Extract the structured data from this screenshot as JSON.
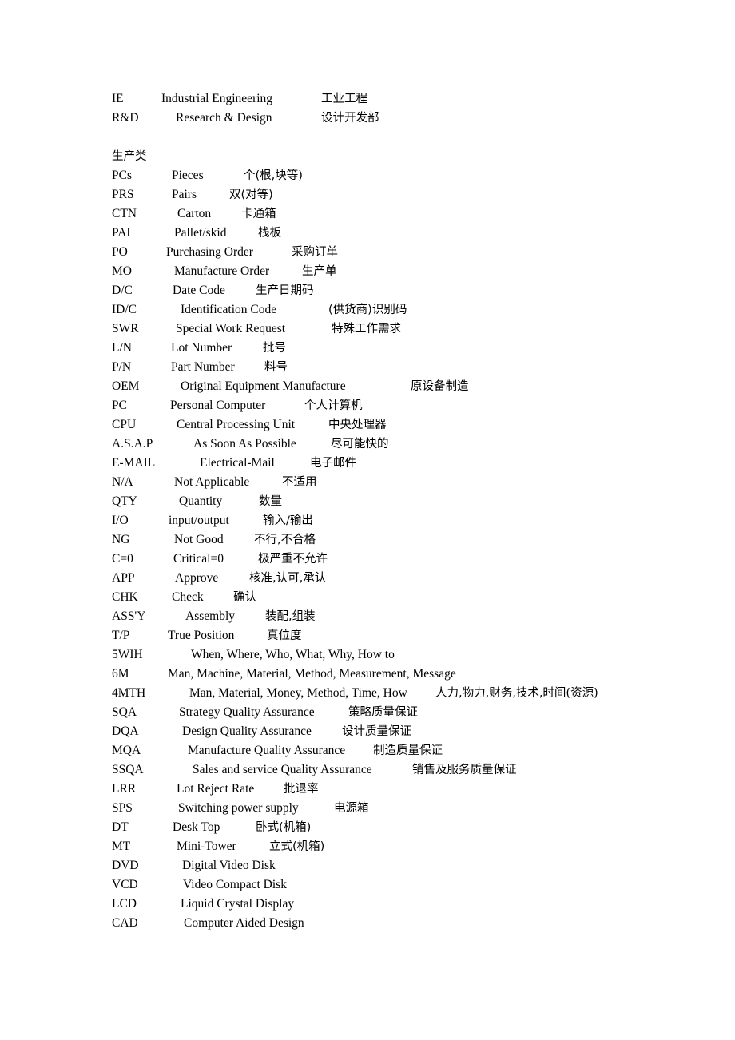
{
  "document": {
    "type": "glossary-list",
    "language_note": "English abbreviation / English expansion / Chinese meaning",
    "section_heading": "生产类",
    "rows": [
      {
        "abbr": "IE",
        "term": "Industrial Engineering",
        "cn": "工业工程",
        "abbr_w": 62,
        "term_w": 200
      },
      {
        "abbr": "R&D",
        "term": "Research & Design",
        "cn": "设计开发部",
        "abbr_w": 80,
        "term_w": 182
      },
      {
        "abbr": "",
        "term": "",
        "cn": "",
        "abbr_w": 0,
        "term_w": 0
      },
      {
        "abbr": "",
        "term": "",
        "cn": "",
        "abbr_w": 0,
        "term_w": 0
      },
      {
        "abbr": "PCs",
        "term": "Pieces",
        "cn": "个(根,块等)",
        "abbr_w": 75,
        "term_w": 90
      },
      {
        "abbr": "PRS",
        "term": "Pairs",
        "cn": "双(对等)",
        "abbr_w": 75,
        "term_w": 72
      },
      {
        "abbr": "CTN",
        "term": "Carton",
        "cn": "卡通箱",
        "abbr_w": 82,
        "term_w": 80
      },
      {
        "abbr": "PAL",
        "term": "Pallet/skid",
        "cn": "栈板",
        "abbr_w": 78,
        "term_w": 105
      },
      {
        "abbr": "PO",
        "term": "Purchasing Order",
        "cn": "采购订单",
        "abbr_w": 68,
        "term_w": 157
      },
      {
        "abbr": "MO",
        "term": "Manufacture Order",
        "cn": "生产单",
        "abbr_w": 78,
        "term_w": 160
      },
      {
        "abbr": "D/C",
        "term": "Date Code",
        "cn": "生产日期码",
        "abbr_w": 76,
        "term_w": 104
      },
      {
        "abbr": "ID/C",
        "term": "Identification Code",
        "cn": "(供货商)识别码",
        "abbr_w": 86,
        "term_w": 185
      },
      {
        "abbr": "SWR",
        "term": "Special Work Request",
        "cn": "特殊工作需求",
        "abbr_w": 80,
        "term_w": 195
      },
      {
        "abbr": "L/N",
        "term": "Lot Number",
        "cn": "批号",
        "abbr_w": 74,
        "term_w": 115
      },
      {
        "abbr": "P/N",
        "term": "Part Number",
        "cn": "料号",
        "abbr_w": 74,
        "term_w": 117
      },
      {
        "abbr": "OEM",
        "term": "Original Equipment Manufacture",
        "cn": "原设备制造",
        "abbr_w": 86,
        "term_w": 288
      },
      {
        "abbr": "PC",
        "term": "Personal Computer",
        "cn": "个人计算机",
        "abbr_w": 73,
        "term_w": 168
      },
      {
        "abbr": "CPU",
        "term": "Central Processing Unit",
        "cn": "中央处理器",
        "abbr_w": 81,
        "term_w": 190
      },
      {
        "abbr": "A.S.A.P",
        "term": "As Soon As Possible",
        "cn": "尽可能快的",
        "abbr_w": 102,
        "term_w": 172
      },
      {
        "abbr": "E-MAIL",
        "term": "Electrical-Mail",
        "cn": "电子邮件",
        "abbr_w": 110,
        "term_w": 138
      },
      {
        "abbr": "N/A",
        "term": "Not Applicable",
        "cn": "不适用",
        "abbr_w": 78,
        "term_w": 135
      },
      {
        "abbr": "QTY",
        "term": "Quantity",
        "cn": "数量",
        "abbr_w": 84,
        "term_w": 100
      },
      {
        "abbr": "I/O",
        "term": "input/output",
        "cn": "输入/输出",
        "abbr_w": 71,
        "term_w": 118
      },
      {
        "abbr": "NG",
        "term": "Not Good",
        "cn": "不行,不合格",
        "abbr_w": 78,
        "term_w": 100
      },
      {
        "abbr": "C=0",
        "term": "Critical=0",
        "cn": "极严重不允许",
        "abbr_w": 77,
        "term_w": 106
      },
      {
        "abbr": "APP",
        "term": "Approve",
        "cn": "核准,认可,承认",
        "abbr_w": 79,
        "term_w": 93
      },
      {
        "abbr": "CHK",
        "term": "Check",
        "cn": "确认",
        "abbr_w": 75,
        "term_w": 77
      },
      {
        "abbr": "ASS'Y",
        "term": "Assembly",
        "cn": "装配,组装",
        "abbr_w": 92,
        "term_w": 100
      },
      {
        "abbr": "T/P",
        "term": "True Position",
        "cn": "真位度",
        "abbr_w": 70,
        "term_w": 124
      },
      {
        "abbr": "5WIH",
        "term": "When, Where, Who, What, Why, How to",
        "cn": "",
        "abbr_w": 99,
        "term_w": 0
      },
      {
        "abbr": "6M",
        "term": "Man, Machine, Material, Method, Measurement, Message",
        "cn": "",
        "abbr_w": 70,
        "term_w": 0
      },
      {
        "abbr": "4MTH",
        "term": "Man, Material, Money, Method, Time, How",
        "cn": "人力,物力,财务,技术,时间(资源)",
        "abbr_w": 97,
        "term_w": 308
      },
      {
        "abbr": "SQA",
        "term": "Strategy Quality Assurance",
        "cn": "策略质量保证",
        "abbr_w": 84,
        "term_w": 212
      },
      {
        "abbr": "DQA",
        "term": "Design Quality Assurance",
        "cn": "设计质量保证",
        "abbr_w": 88,
        "term_w": 200
      },
      {
        "abbr": "MQA",
        "term": "Manufacture Quality Assurance",
        "cn": "制造质量保证",
        "abbr_w": 95,
        "term_w": 232
      },
      {
        "abbr": "SSQA",
        "term": "Sales and service Quality Assurance",
        "cn": "销售及服务质量保证",
        "abbr_w": 101,
        "term_w": 275
      },
      {
        "abbr": "LRR",
        "term": "Lot Reject Rate",
        "cn": "批退率",
        "abbr_w": 81,
        "term_w": 134
      },
      {
        "abbr": "SPS",
        "term": "Switching power supply",
        "cn": "电源箱",
        "abbr_w": 83,
        "term_w": 195
      },
      {
        "abbr": "DT",
        "term": "Desk Top",
        "cn": "卧式(机箱)",
        "abbr_w": 76,
        "term_w": 104
      },
      {
        "abbr": "MT",
        "term": "Mini-Tower",
        "cn": "立式(机箱)",
        "abbr_w": 81,
        "term_w": 116
      },
      {
        "abbr": "DVD",
        "term": "Digital Video Disk",
        "cn": "",
        "abbr_w": 88,
        "term_w": 0
      },
      {
        "abbr": "VCD",
        "term": "Video Compact Disk",
        "cn": "",
        "abbr_w": 89,
        "term_w": 0
      },
      {
        "abbr": "LCD",
        "term": "Liquid Crystal Display",
        "cn": "",
        "abbr_w": 86,
        "term_w": 0
      },
      {
        "abbr": "CAD",
        "term": "Computer Aided Design",
        "cn": "",
        "abbr_w": 90,
        "term_w": 0
      }
    ]
  }
}
